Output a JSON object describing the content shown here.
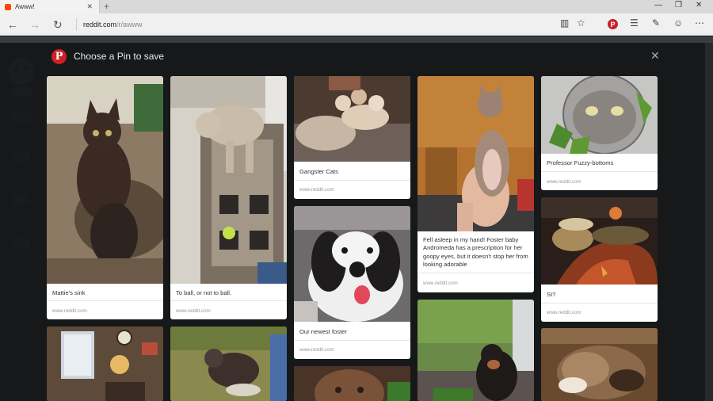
{
  "browser": {
    "tab_title": "Awww!",
    "url_host": "reddit.com",
    "url_path": "/r/awww"
  },
  "modal": {
    "title": "Choose a Pin to save"
  },
  "pins": [
    {
      "desc": "Mattie's sink",
      "source": "www.reddit.com"
    },
    {
      "desc": "To ball, or not to ball.",
      "source": "www.reddit.com"
    },
    {
      "desc": "Gangster Cats",
      "source": "www.reddit.com"
    },
    {
      "desc": "Our newest foster",
      "source": "www.reddit.com"
    },
    {
      "desc": "Fell asleep in my hand! Foster baby Andromeda has a prescription for her goopy eyes, but it doesn't stop her from looking adorable",
      "source": "www.reddit.com"
    },
    {
      "desc": "Professor Fuzzy-bottoms",
      "source": "www.reddit.com"
    },
    {
      "desc": "SI?",
      "source": "www.reddit.com"
    }
  ]
}
